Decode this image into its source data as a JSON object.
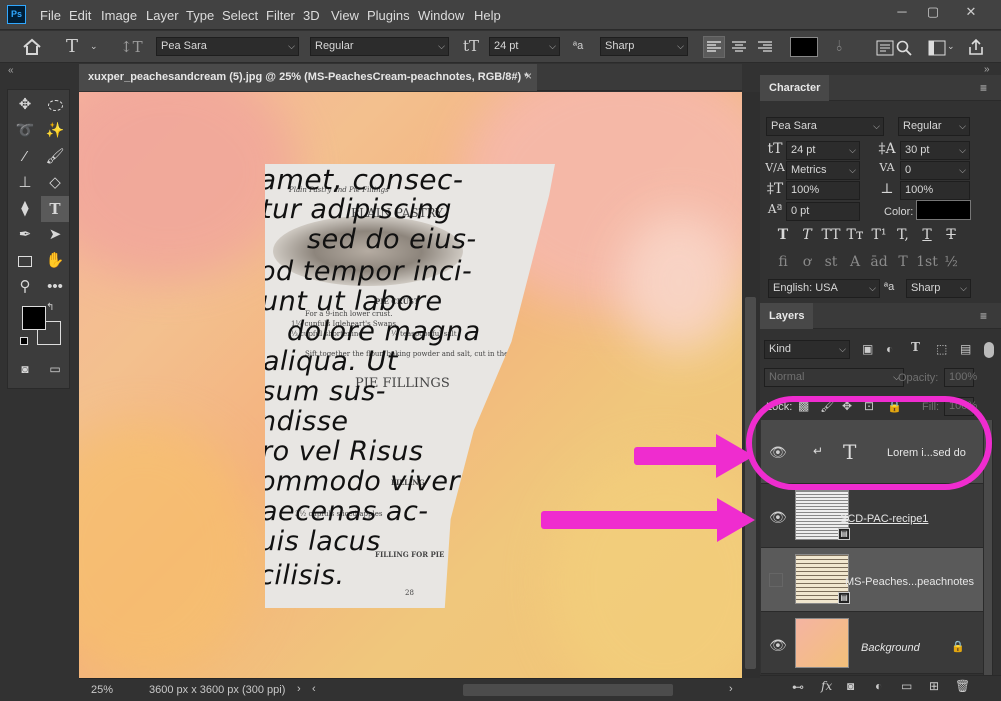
{
  "app": {
    "logo": "Ps",
    "window_controls": [
      "─",
      "▢",
      "✕"
    ]
  },
  "menu": [
    "File",
    "Edit",
    "Image",
    "Layer",
    "Type",
    "Select",
    "Filter",
    "3D",
    "View",
    "Plugins",
    "Window",
    "Help"
  ],
  "options": {
    "font_family": "Pea Sara",
    "font_style": "Regular",
    "font_size": "24 pt",
    "antialias_label": "ªa",
    "antialias": "Sharp"
  },
  "document": {
    "tab_title": "xuxper_peachesandcream (5).jpg @ 25% (MS-PeachesCream-peachnotes, RGB/8#) *",
    "close": "×"
  },
  "canvas": {
    "handwriting": [
      "amet, consec-",
      "tur adipiscing",
      "sed do eius-",
      "od tempor inci-",
      "unt ut labore",
      "dolore magna",
      "aliqua. Ut",
      "sum sus-",
      "ndisse",
      "ro vel Risus",
      "ommodo viverra",
      "aecenas ac-",
      "uis lacus",
      "cilisis."
    ],
    "print": [
      "Plain Pastry and Pie Fillings",
      "PLAIN PASTRY",
      "PIE CRUST",
      "For a 9-inch lower crust.",
      "1¼ cupfuls Igleheart's Swans",
      "⅓ cupful shortening",
      "¼ teaspoonful salt",
      "Sift together the flour, baking powder and salt, cut in the shortening",
      "PIE FILLINGS",
      "FILLING",
      "3½ cupfuls sliced apples",
      "FILLING FOR PIE",
      "28"
    ]
  },
  "status": {
    "zoom": "25%",
    "doc_info": "3600 px x 3600 px (300 ppi)",
    "arrow": "›"
  },
  "character": {
    "panel_title": "Character",
    "font_family": "Pea Sara",
    "font_style": "Regular",
    "size": "24 pt",
    "leading": "30 pt",
    "kerning": "Metrics",
    "tracking": "0",
    "vscale": "100%",
    "hscale": "100%",
    "baseline": "0 pt",
    "color_label": "Color:",
    "language": "English: USA",
    "antialias_label": "ªa",
    "antialias": "Sharp",
    "type_buttons": [
      "T",
      "T",
      "TT",
      "Tт",
      "T¹",
      "T,",
      "T",
      "T"
    ],
    "ot_buttons": [
      "fi",
      "ơ",
      "st",
      "A",
      "ād",
      "T",
      "1st",
      "½"
    ]
  },
  "layers": {
    "panel_title": "Layers",
    "filter": "Kind",
    "blend": "Normal",
    "opacity_label": "Opacity:",
    "opacity": "100%",
    "lock_label": "Lock:",
    "fill_label": "Fill:",
    "fill": "100%",
    "items": [
      {
        "name": "Lorem i...sed do",
        "type": "text",
        "visible": true
      },
      {
        "name": "SCD-PAC-recipe1",
        "type": "image",
        "visible": true
      },
      {
        "name": "MS-Peaches...peachnotes",
        "type": "image",
        "visible": false
      },
      {
        "name": "Background",
        "type": "background",
        "visible": true
      }
    ]
  },
  "annotation_color": "#ef2ccf"
}
